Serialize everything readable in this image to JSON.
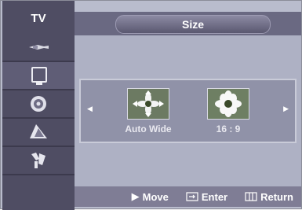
{
  "sidebar": {
    "title": "TV",
    "items": [
      {
        "icon": "input-plug-icon"
      },
      {
        "icon": "picture-icon"
      },
      {
        "icon": "sound-speaker-icon"
      },
      {
        "icon": "channel-satellite-icon"
      },
      {
        "icon": "setup-tools-icon"
      }
    ],
    "active_index": 1
  },
  "header": {
    "title": "Size"
  },
  "size_options": [
    {
      "label": "Auto Wide",
      "selected": true
    },
    {
      "label": "16 : 9",
      "selected": false
    }
  ],
  "footer": {
    "move_label": "Move",
    "enter_label": "Enter",
    "return_label": "Return"
  },
  "colors": {
    "sidebar_bg": "#4f4d63",
    "panel_bg": "#b9bccd",
    "header_bg": "#6a6982",
    "footer_bg": "#7f7d95"
  }
}
